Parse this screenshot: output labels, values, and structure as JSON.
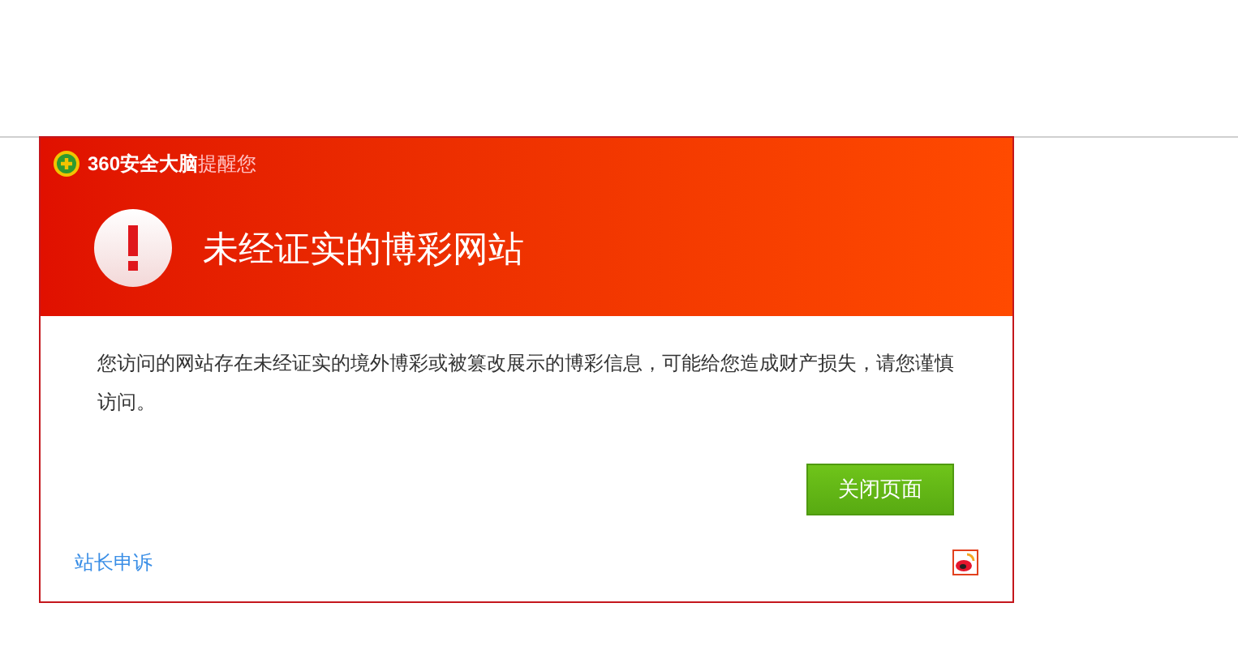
{
  "header": {
    "brand": "360安全大脑",
    "brand_suffix": "提醒您",
    "title": "未经证实的博彩网站"
  },
  "message": "您访问的网站存在未经证实的境外博彩或被篡改展示的博彩信息，可能给您造成财产损失，请您谨慎访问。",
  "close_button": "关闭页面",
  "footer": {
    "link": "站长申诉"
  }
}
